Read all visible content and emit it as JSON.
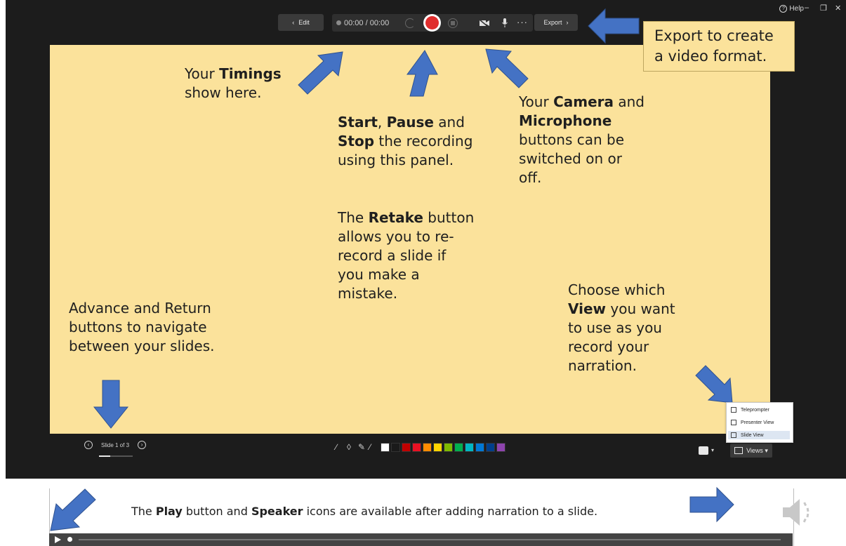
{
  "window": {
    "help_label": "Help",
    "minimize_glyph": "–",
    "restore_glyph": "❐",
    "close_glyph": "✕"
  },
  "toolbar": {
    "edit_label": "Edit",
    "edit_chevron": "‹",
    "timer": "00:00 / 00:00",
    "more_glyph": "···",
    "export_label": "Export",
    "export_chevron": "›"
  },
  "slide": {
    "timings": {
      "line1_pre": "Your ",
      "line1_bold": "Timings",
      "line2": "show here."
    },
    "record": {
      "l1_b1": "Start",
      "l1_mid": ", ",
      "l1_b2": "Pause",
      "l1_post": " and",
      "l2_b": "Stop",
      "l2_post": " the recording",
      "l3": "using this panel."
    },
    "retake": {
      "l1_pre": "The ",
      "l1_b": "Retake",
      "l1_post": " button",
      "l2": "allows you to re-",
      "l3": "record a slide if",
      "l4": "you make a",
      "l5": "mistake."
    },
    "camera": {
      "l1_pre": "Your ",
      "l1_b": "Camera",
      "l1_post": " and",
      "l2_b": "Microphone",
      "l3": "buttons can be",
      "l4": "switched on or",
      "l5": "off."
    },
    "export_callout": {
      "l1": "Export to create",
      "l2": "a video format."
    },
    "navigate": {
      "l1": "Advance and Return",
      "l2": "buttons to navigate",
      "l3": "between your slides."
    },
    "views": {
      "l1": "Choose which",
      "l2_b": "View",
      "l2_post": " you want",
      "l3": "to use as you",
      "l4": "record your",
      "l5": "narration."
    }
  },
  "bottom_bar": {
    "prev_glyph": "‹",
    "next_glyph": "›",
    "slide_counter": "Slide 1 of 3",
    "views_label": "Views ▾",
    "person_drop": "▾",
    "pen_colors": [
      "#ffffff",
      "#1a1a1a",
      "#c00000",
      "#e81123",
      "#ff8c00",
      "#ffd400",
      "#7fba00",
      "#00b050",
      "#00b7c3",
      "#0078d4",
      "#003f8a",
      "#8e44ad"
    ]
  },
  "views_menu": {
    "items": [
      "Teleprompter",
      "Presenter View",
      "Slide View"
    ],
    "selected": "Slide View"
  },
  "player": {
    "pre": "The ",
    "b1": "Play",
    "mid": " button and ",
    "b2": "Speaker",
    "post": " icons are available after adding narration to a slide."
  },
  "colors": {
    "slide_bg": "#fbe29b",
    "app_bg": "#1c1c1c",
    "arrow_blue": "#4472c4",
    "record_red": "#e02d2d"
  }
}
